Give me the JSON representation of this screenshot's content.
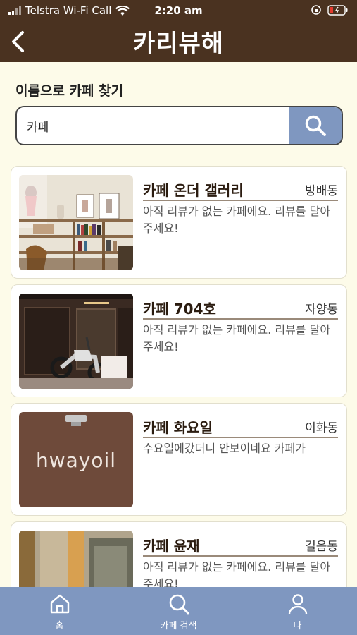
{
  "status_bar": {
    "carrier": "Telstra Wi-Fi Call",
    "time": "2:20 am"
  },
  "header": {
    "title": "카리뷰해",
    "back_icon": "chevron-left-icon"
  },
  "search": {
    "label": "이름으로 카페 찾기",
    "value": "카페",
    "button_icon": "search-icon"
  },
  "cafes": [
    {
      "name": "카페 온더 갤러리",
      "location": "방배동",
      "review": "아직 리뷰가 없는 카페에요. 리뷰를 달아주세요!"
    },
    {
      "name": "카페 704호",
      "location": "자양동",
      "review": "아직 리뷰가 없는 카페에요. 리뷰를 달아주세요!"
    },
    {
      "name": "카페 화요일",
      "location": "이화동",
      "review": "수요일에갔더니 안보이네요 카페가",
      "photo_sign_text": "hwayoil"
    },
    {
      "name": "카페 윤재",
      "location": "길음동",
      "review": "아직 리뷰가 없는 카페에요. 리뷰를 달아주세요!"
    }
  ],
  "tabs": [
    {
      "label": "홈",
      "icon": "home-icon"
    },
    {
      "label": "카페 검색",
      "icon": "search-icon"
    },
    {
      "label": "나",
      "icon": "user-icon"
    }
  ],
  "colors": {
    "header_bg": "#4a3220",
    "page_bg": "#fdfbe9",
    "accent": "#7f97c0",
    "card_border": "#e2dfcd"
  }
}
